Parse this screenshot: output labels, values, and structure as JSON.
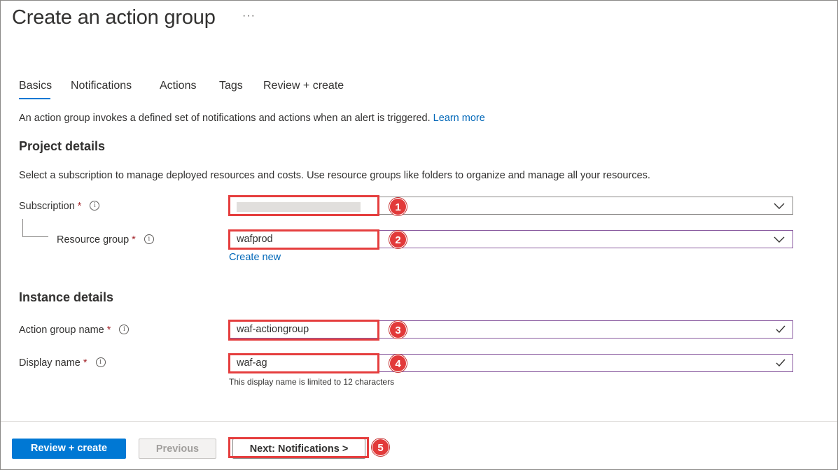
{
  "page": {
    "title": "Create an action group",
    "more": "···"
  },
  "tabs": [
    {
      "label": "Basics",
      "active": true
    },
    {
      "label": "Notifications"
    },
    {
      "label": "Actions"
    },
    {
      "label": "Tags"
    },
    {
      "label": "Review + create"
    }
  ],
  "intro": {
    "text": "An action group invokes a defined set of notifications and actions when an alert is triggered.",
    "link": "Learn more"
  },
  "project": {
    "heading": "Project details",
    "helper": "Select a subscription to manage deployed resources and costs. Use resource groups like folders to organize and manage all your resources.",
    "subscription": {
      "label": "Subscription",
      "required": "*",
      "value": ""
    },
    "resource_group": {
      "label": "Resource group",
      "required": "*",
      "value": "wafprod",
      "create_new": "Create new"
    }
  },
  "instance": {
    "heading": "Instance details",
    "action_group_name": {
      "label": "Action group name",
      "required": "*",
      "value": "waf-actiongroup"
    },
    "display_name": {
      "label": "Display name",
      "required": "*",
      "value": "waf-ag",
      "hint": "This display name is limited to 12 characters"
    }
  },
  "annotations": [
    "1",
    "2",
    "3",
    "4",
    "5"
  ],
  "footer": {
    "review_create": "Review + create",
    "previous": "Previous",
    "next": "Next: Notifications >"
  },
  "colors": {
    "accent": "#0078d4",
    "link": "#0067b8",
    "required": "#a4262c",
    "annotation": "#e53e3e"
  },
  "icons": {
    "info": "info-icon",
    "dropdown": "chevron-down-icon",
    "valid": "checkmark-icon"
  }
}
